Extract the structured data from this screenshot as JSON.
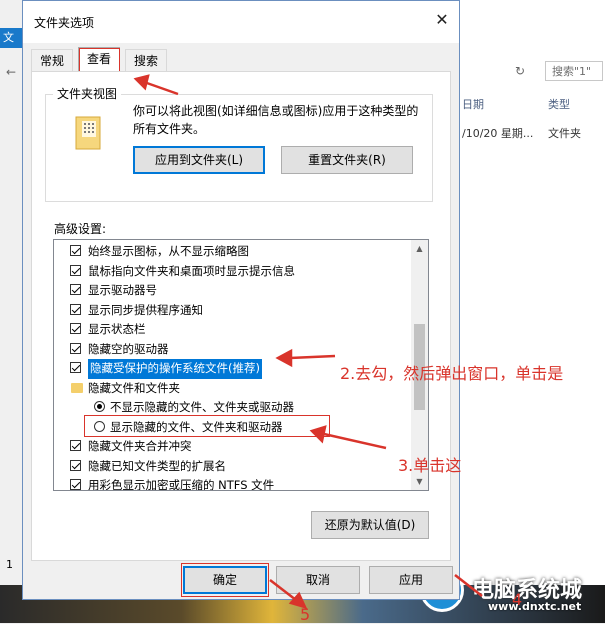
{
  "background": {
    "left_tab": "文",
    "search_placeholder": "搜索\"1\"",
    "col_date": "日期",
    "col_type": "类型",
    "cell_date": "/10/20 星期...",
    "cell_type": "文件夹",
    "left_number": "1",
    "watermark_big": "电脑系统城",
    "watermark_url": "www.dnxtc.net"
  },
  "dialog": {
    "title": "文件夹选项",
    "close_glyph": "✕",
    "tabs": [
      "常规",
      "查看",
      "搜索"
    ],
    "folder_view": {
      "label": "文件夹视图",
      "description": "你可以将此视图(如详细信息或图标)应用于这种类型的所有文件夹。",
      "apply_button": "应用到文件夹(L)",
      "reset_button": "重置文件夹(R)"
    },
    "advanced_label": "高级设置:",
    "advanced_items": [
      "始终显示图标，从不显示缩略图",
      "鼠标指向文件夹和桌面项时显示提示信息",
      "显示驱动器号",
      "显示同步提供程序通知",
      "显示状态栏",
      "隐藏空的驱动器",
      "隐藏受保护的操作系统文件(推荐)",
      "隐藏文件和文件夹",
      "不显示隐藏的文件、文件夹或驱动器",
      "显示隐藏的文件、文件夹和驱动器",
      "隐藏文件夹合并冲突",
      "隐藏已知文件类型的扩展名",
      "用彩色显示加密或压缩的 NTFS 文件"
    ],
    "restore_button": "还原为默认值(D)",
    "ok_button": "确定",
    "cancel_button": "取消",
    "apply_button": "应用"
  },
  "annotations": {
    "step2": "2.去勾，然后弹出窗口，单击是",
    "step3": "3.单击这",
    "step4": "4",
    "step5": "5"
  },
  "colors": {
    "accent": "#0078d7",
    "annotation": "#d9342b"
  }
}
